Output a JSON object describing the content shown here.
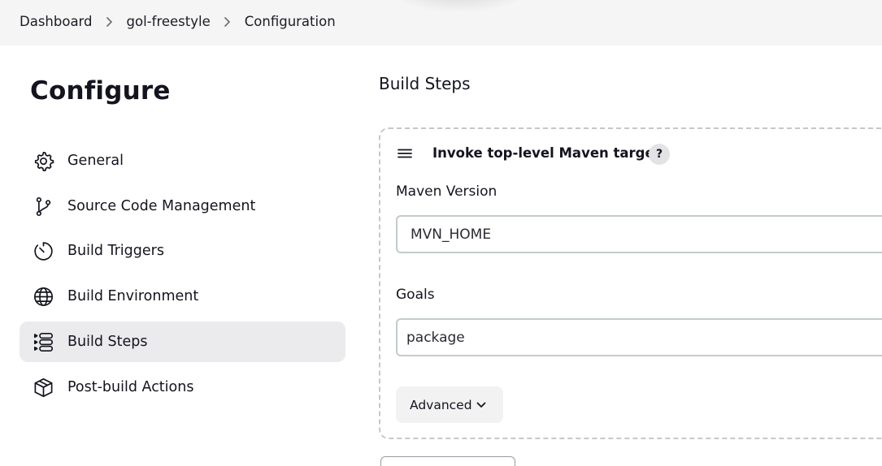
{
  "breadcrumb": {
    "items": [
      {
        "label": "Dashboard"
      },
      {
        "label": "gol-freestyle"
      },
      {
        "label": "Configuration"
      }
    ]
  },
  "page": {
    "title": "Configure"
  },
  "sidebar": {
    "items": [
      {
        "label": "General",
        "icon": "gear-icon"
      },
      {
        "label": "Source Code Management",
        "icon": "branch-icon"
      },
      {
        "label": "Build Triggers",
        "icon": "timer-icon"
      },
      {
        "label": "Build Environment",
        "icon": "globe-icon"
      },
      {
        "label": "Build Steps",
        "icon": "steps-list-icon",
        "active": true
      },
      {
        "label": "Post-build Actions",
        "icon": "package-icon"
      }
    ]
  },
  "main": {
    "section_title": "Build Steps",
    "step": {
      "title": "Invoke top-level Maven targets",
      "help": "?",
      "maven_version": {
        "label": "Maven Version",
        "value": "MVN_HOME"
      },
      "goals": {
        "label": "Goals",
        "value": "package"
      },
      "advanced_label": "Advanced"
    }
  },
  "colors": {
    "active_bg": "#ebebed",
    "topbar_bg": "#f5f5f6",
    "text": "#14141f",
    "input_border": "#c4ccc6"
  }
}
